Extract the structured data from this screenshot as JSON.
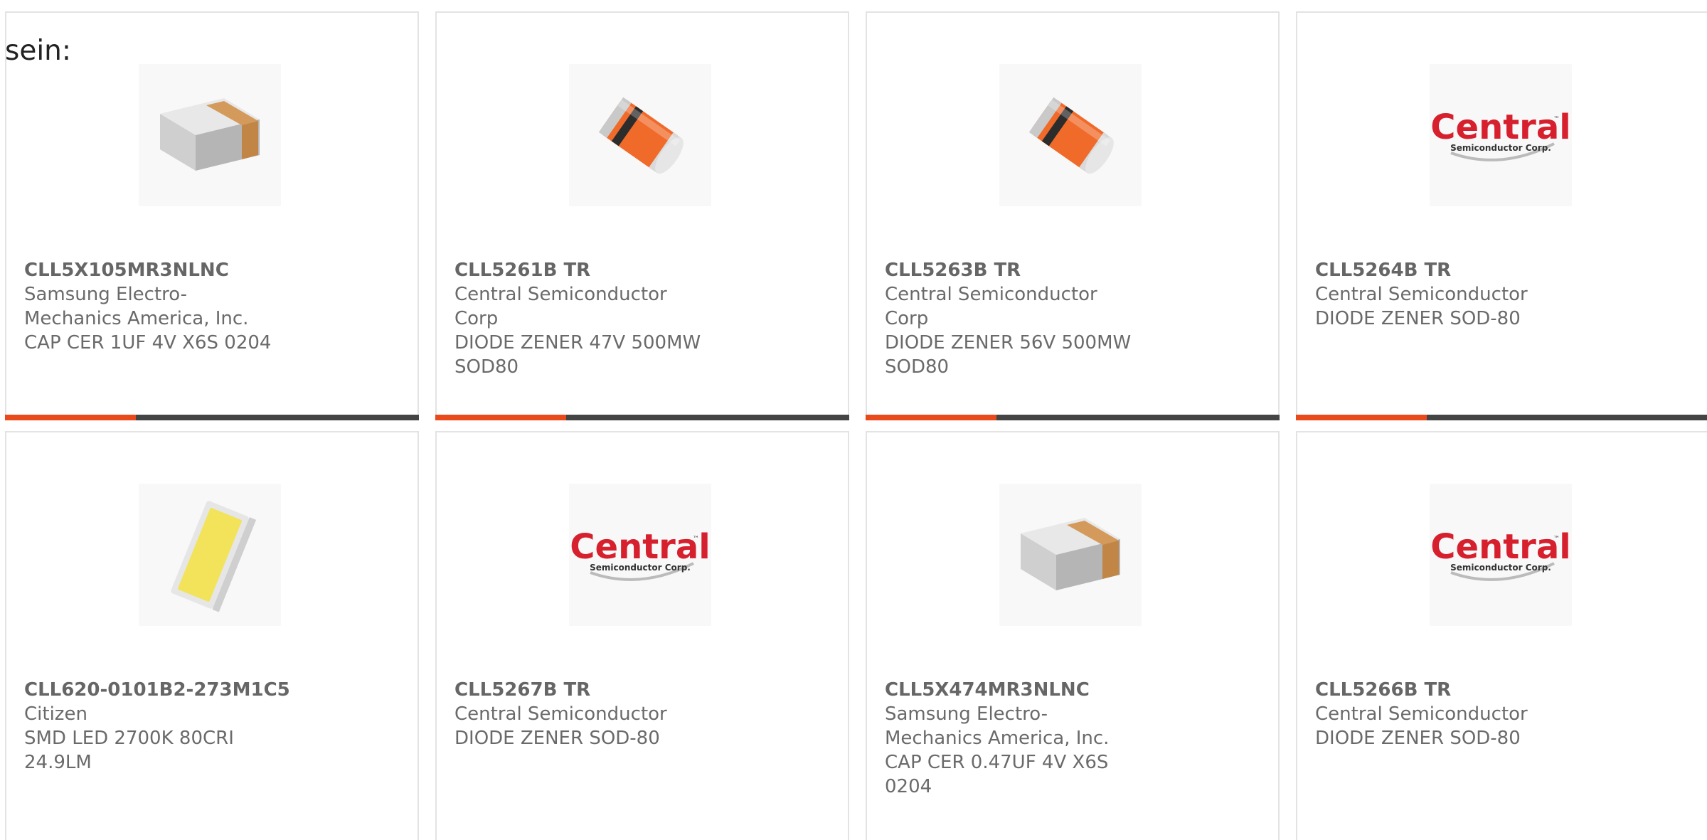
{
  "intro_text": "sein:",
  "colors": {
    "accent": "#e84a1c",
    "bar_dark": "#444444",
    "border": "#e3e3e3",
    "text": "#6a6a6a"
  },
  "products": [
    {
      "part_number": "CLL5X105MR3NLNC",
      "manufacturer": "Samsung Electro-Mechanics America, Inc.",
      "description": "CAP CER 1UF 4V X6S 0204",
      "image": "ceramic-capacitor-image"
    },
    {
      "part_number": "CLL5261B TR",
      "manufacturer": "Central Semiconductor Corp",
      "description": "DIODE ZENER 47V 500MW SOD80",
      "image": "zener-diode-image"
    },
    {
      "part_number": "CLL5263B TR",
      "manufacturer": "Central Semiconductor Corp",
      "description": "DIODE ZENER 56V 500MW SOD80",
      "image": "zener-diode-image"
    },
    {
      "part_number": "CLL5264B TR",
      "manufacturer": "Central Semiconductor",
      "description": "DIODE ZENER SOD-80",
      "image": "central-logo-image"
    },
    {
      "part_number": "CLL620-0101B2-273M1C5",
      "manufacturer": "Citizen",
      "description": "SMD LED 2700K 80CRI 24.9LM",
      "image": "smd-led-image"
    },
    {
      "part_number": "CLL5267B TR",
      "manufacturer": "Central Semiconductor",
      "description": "DIODE ZENER SOD-80",
      "image": "central-logo-image"
    },
    {
      "part_number": "CLL5X474MR3NLNC",
      "manufacturer": "Samsung Electro-Mechanics America, Inc.",
      "description": "CAP CER 0.47UF 4V X6S 0204",
      "image": "ceramic-capacitor-image"
    },
    {
      "part_number": "CLL5266B TR",
      "manufacturer": "Central Semiconductor",
      "description": "DIODE ZENER SOD-80",
      "image": "central-logo-image"
    }
  ],
  "logo_text": {
    "brand": "Central",
    "tagline": "Semiconductor Corp.",
    "tm": "™"
  }
}
